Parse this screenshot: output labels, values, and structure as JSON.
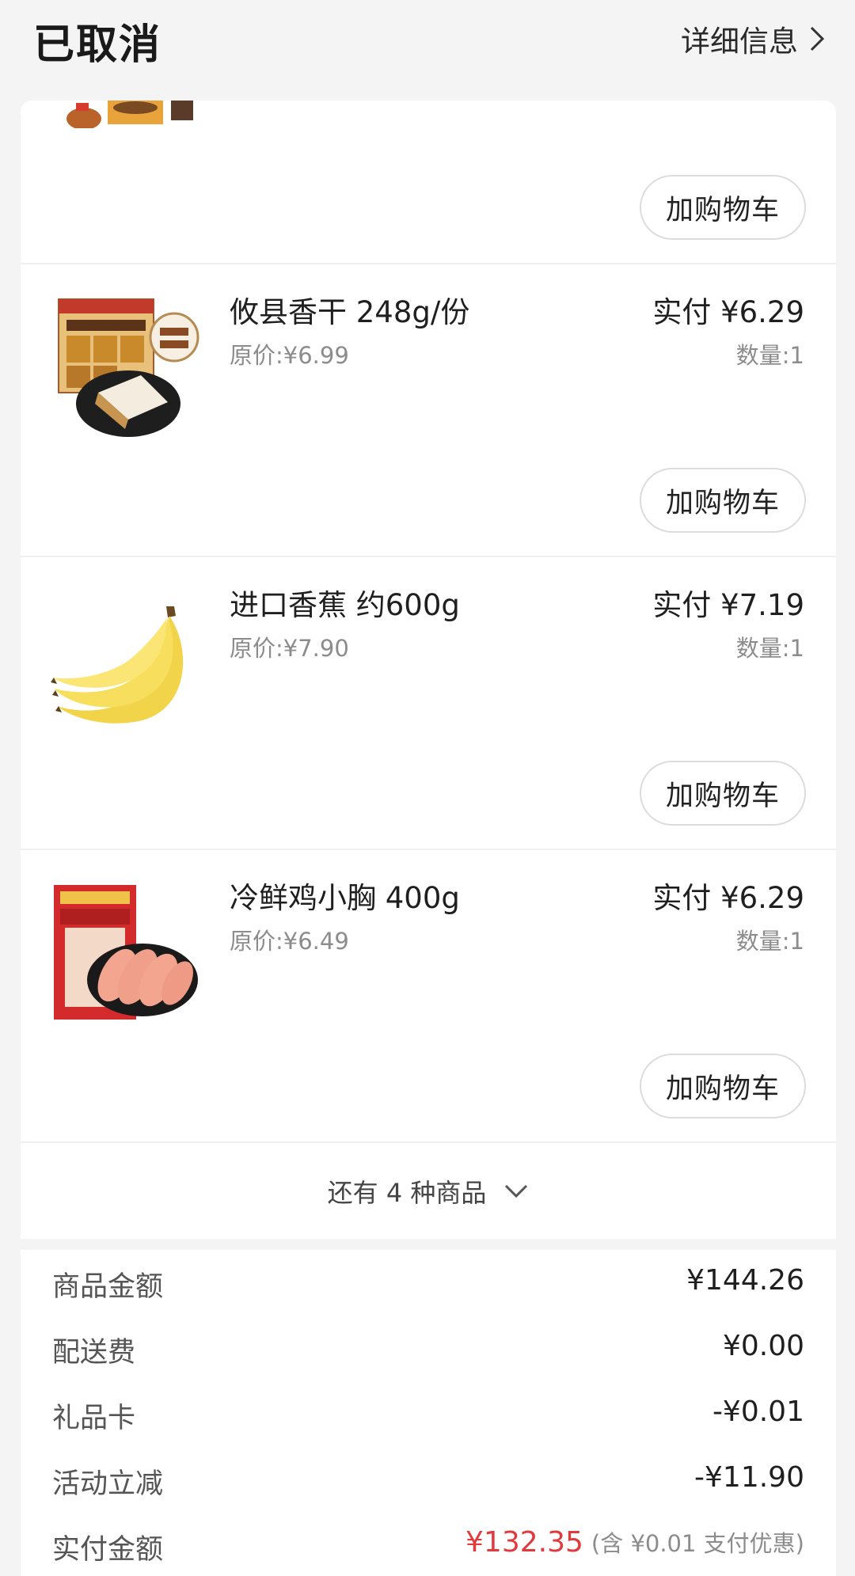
{
  "header": {
    "status": "已取消",
    "detail_label": "详细信息"
  },
  "items": [
    {
      "name": "",
      "original_price": "",
      "paid": "",
      "quantity": "",
      "cart_label": "加购物车"
    },
    {
      "name": "攸县香干 248g/份",
      "original_price": "原价:¥6.99",
      "paid": "实付 ¥6.29",
      "quantity": "数量:1",
      "cart_label": "加购物车"
    },
    {
      "name": "进口香蕉 约600g",
      "original_price": "原价:¥7.90",
      "paid": "实付 ¥7.19",
      "quantity": "数量:1",
      "cart_label": "加购物车"
    },
    {
      "name": "冷鲜鸡小胸 400g",
      "original_price": "原价:¥6.49",
      "paid": "实付 ¥6.29",
      "quantity": "数量:1",
      "cart_label": "加购物车"
    }
  ],
  "more_items": "还有 4 种商品",
  "summary": {
    "goods_label": "商品金额",
    "goods_value": "¥144.26",
    "delivery_label": "配送费",
    "delivery_value": "¥0.00",
    "giftcard_label": "礼品卡",
    "giftcard_value": "-¥0.01",
    "discount_label": "活动立减",
    "discount_value": "-¥11.90",
    "total_label": "实付金额",
    "total_value": "¥132.35",
    "total_note": "(含 ¥0.01 支付优惠)"
  },
  "colors": {
    "total_red": "#e0393e",
    "background": "#f4f4f4"
  }
}
